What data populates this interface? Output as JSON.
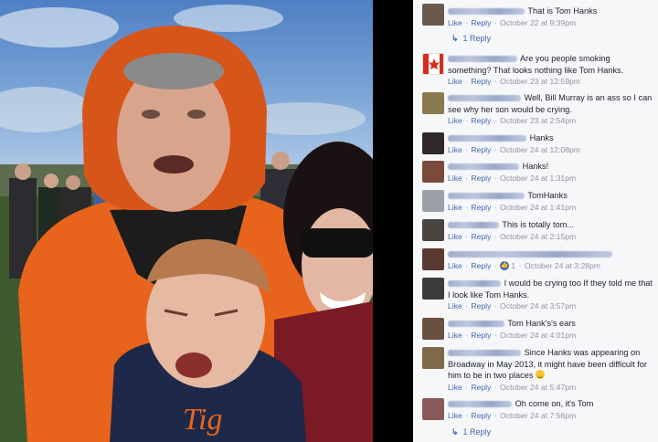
{
  "comments": [
    {
      "text": "That is Tom Hanks",
      "likes": "Like",
      "reply": "Reply",
      "time": "October 22 at 9:39pm",
      "replies": "1 Reply",
      "avatar": "#6b5a4c"
    },
    {
      "text": "Are you people smoking something? That looks nothing like Tom Hanks.",
      "likes": "Like",
      "reply": "Reply",
      "time": "October 23 at 12:59pm",
      "avatar": "#d8403c"
    },
    {
      "text": "Well, Bill Murray is an ass so I can see why her son would be crying.",
      "likes": "Like",
      "reply": "Reply",
      "time": "October 23 at 2:54pm",
      "avatar": "#8a7a50"
    },
    {
      "text": "Hanks",
      "likes": "Like",
      "reply": "Reply",
      "time": "October 24 at 12:08pm",
      "avatar": "#2f2a28"
    },
    {
      "text": "Hanks!",
      "likes": "Like",
      "reply": "Reply",
      "time": "October 24 at 1:31pm",
      "avatar": "#7a4a3a"
    },
    {
      "text": "TomHanks",
      "likes": "Like",
      "reply": "Reply",
      "time": "October 24 at 1:41pm",
      "avatar": "#9aa0a8"
    },
    {
      "text": "This is totally tom...",
      "likes": "Like",
      "reply": "Reply",
      "time": "October 24 at 2:15pm",
      "avatar": "#4a4440"
    },
    {
      "text": "",
      "likes": "Like",
      "reply": "Reply",
      "reaction_count": "1",
      "time": "October 24 at 3:28pm",
      "avatar": "#5a3b32"
    },
    {
      "text": "I would be crying too If they told me that I look like Tom Hanks.",
      "likes": "Like",
      "reply": "Reply",
      "time": "October 24 at 3:57pm",
      "avatar": "#3b3b3b"
    },
    {
      "text": "Tom Hank's's ears",
      "likes": "Like",
      "reply": "Reply",
      "time": "October 24 at 4:01pm",
      "avatar": "#6a5040"
    },
    {
      "text": "Since Hanks was appearing on Broadway in May 2013, it might have been difficult for him to be in two places",
      "likes": "Like",
      "reply": "Reply",
      "time": "October 24 at 5:47pm",
      "avatar": "#7c6a4a"
    },
    {
      "text": "Oh come on, it's Tom",
      "likes": "Like",
      "reply": "Reply",
      "time": "October 24 at 7:56pm",
      "replies": "1 Reply",
      "avatar": "#8a5a5a"
    }
  ],
  "colors": {
    "link": "#4267b2",
    "meta": "#90949c",
    "panel": "#f6f7f9"
  }
}
